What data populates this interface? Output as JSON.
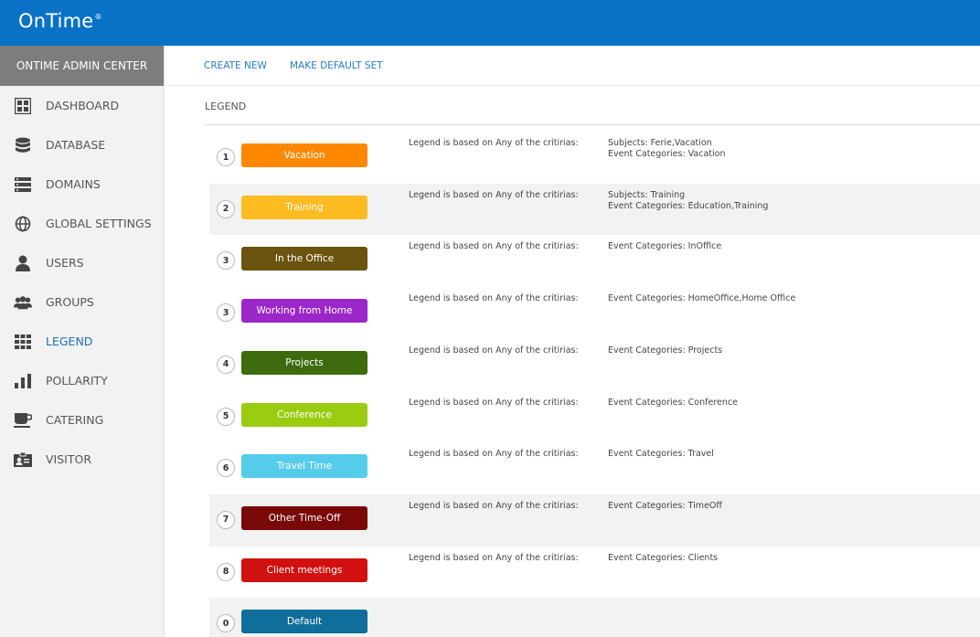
{
  "app": {
    "logo": "OnTime",
    "logo_mark": "®"
  },
  "sidebar": {
    "header": "ONTIME ADMIN CENTER",
    "items": [
      {
        "label": "DASHBOARD",
        "icon": "dashboard-icon"
      },
      {
        "label": "DATABASE",
        "icon": "database-icon"
      },
      {
        "label": "DOMAINS",
        "icon": "domains-icon"
      },
      {
        "label": "GLOBAL SETTINGS",
        "icon": "global-settings-icon"
      },
      {
        "label": "USERS",
        "icon": "user-icon"
      },
      {
        "label": "GROUPS",
        "icon": "groups-icon"
      },
      {
        "label": "LEGEND",
        "icon": "legend-icon",
        "active": true
      },
      {
        "label": "POLLARITY",
        "icon": "bar-chart-icon"
      },
      {
        "label": "CATERING",
        "icon": "coffee-cup-icon"
      },
      {
        "label": "VISITOR",
        "icon": "visitor-badge-icon"
      }
    ]
  },
  "toolbar": {
    "create_new": "CREATE NEW",
    "make_default_set": "MAKE DEFAULT SET"
  },
  "main": {
    "title": "LEGEND",
    "rule_text": "Legend is based on Any of the critirias:",
    "legends": [
      {
        "number": "1",
        "label": "Vacation",
        "color": "#ff8800",
        "criteria": [
          "Subjects: Ferie,Vacation",
          "Event Categories: Vacation"
        ]
      },
      {
        "number": "2",
        "label": "Training",
        "color": "#ffbb22",
        "criteria": [
          "Subjects: Training",
          "Event Categories: Education,Training"
        ]
      },
      {
        "number": "3",
        "label": "In the Office",
        "color": "#6b5310",
        "criteria": [
          "Event Categories: InOffice"
        ]
      },
      {
        "number": "3",
        "label": "Working from Home",
        "color": "#9b27c9",
        "criteria": [
          "Event Categories: HomeOffice,Home Office"
        ]
      },
      {
        "number": "4",
        "label": "Projects",
        "color": "#3d6b0e",
        "criteria": [
          "Event Categories: Projects"
        ]
      },
      {
        "number": "5",
        "label": "Conference",
        "color": "#9acc10",
        "criteria": [
          "Event Categories: Conference"
        ]
      },
      {
        "number": "6",
        "label": "Travel Time",
        "color": "#55ccea",
        "criteria": [
          "Event Categories: Travel"
        ]
      },
      {
        "number": "7",
        "label": "Other Time-Off",
        "color": "#7a0a0a",
        "criteria": [
          "Event Categories: TimeOff"
        ]
      },
      {
        "number": "8",
        "label": "Client meetings",
        "color": "#d11010",
        "criteria": [
          "Event Categories: Clients"
        ]
      },
      {
        "number": "0",
        "label": "Default",
        "color": "#0f6e9a",
        "criteria": []
      }
    ]
  }
}
